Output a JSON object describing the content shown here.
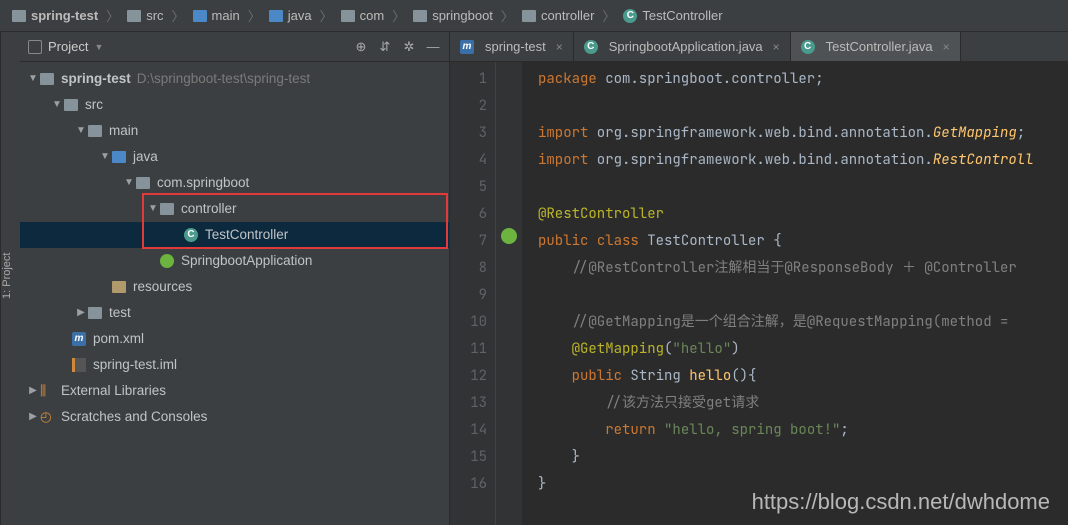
{
  "breadcrumb": {
    "items": [
      {
        "icon": "folder",
        "label": "spring-test"
      },
      {
        "icon": "folder",
        "label": "src"
      },
      {
        "icon": "folder-blue",
        "label": "main"
      },
      {
        "icon": "folder-blue",
        "label": "java"
      },
      {
        "icon": "folder",
        "label": "com"
      },
      {
        "icon": "folder",
        "label": "springboot"
      },
      {
        "icon": "folder",
        "label": "controller"
      },
      {
        "icon": "class",
        "label": "TestController"
      }
    ]
  },
  "sidebar_tab": "1: Project",
  "project_header": {
    "title": "Project"
  },
  "tree": {
    "root": {
      "label": "spring-test",
      "path": "D:\\springboot-test\\spring-test"
    },
    "src": "src",
    "main": "main",
    "java": "java",
    "pkg": "com.springboot",
    "controller": "controller",
    "testController": "TestController",
    "springApp": "SpringbootApplication",
    "resources": "resources",
    "test": "test",
    "pom": "pom.xml",
    "iml": "spring-test.iml",
    "extlib": "External Libraries",
    "scratches": "Scratches and Consoles"
  },
  "tabs": [
    {
      "icon": "maven",
      "label": "spring-test",
      "active": false,
      "closable": true
    },
    {
      "icon": "class",
      "label": "SpringbootApplication.java",
      "active": false,
      "closable": true
    },
    {
      "icon": "class",
      "label": "TestController.java",
      "active": true,
      "closable": true
    }
  ],
  "code": {
    "line_count": 16,
    "l1_kw": "package",
    "l1_rest": " com.springboot.controller;",
    "l3_kw": "import",
    "l3_mid": " org.springframework.web.bind.annotation.",
    "l3_cls": "GetMapping",
    "l3_end": ";",
    "l4_kw": "import",
    "l4_mid": " org.springframework.web.bind.annotation.",
    "l4_cls": "RestControll",
    "l6_ann": "@RestController",
    "l7_pub": "public ",
    "l7_cls": "class ",
    "l7_name": "TestController ",
    "l7_brace": "{",
    "l8_cmt": "//@RestController注解相当于@ResponseBody ＋ @Controller",
    "l10_cmt": "//@GetMapping是一个组合注解，是@RequestMapping(method =",
    "l11_ann": "@GetMapping",
    "l11_paren": "(",
    "l11_str": "\"hello\"",
    "l11_close": ")",
    "l12_pub": "public ",
    "l12_type": "String ",
    "l12_fn": "hello",
    "l12_rest": "(){",
    "l13_cmt": "//该方法只接受get请求",
    "l14_ret": "return ",
    "l14_str": "\"hello, spring boot!\"",
    "l14_semi": ";",
    "l15_brace": "}",
    "l16_brace": "}"
  },
  "watermark": "https://blog.csdn.net/dwhdome"
}
